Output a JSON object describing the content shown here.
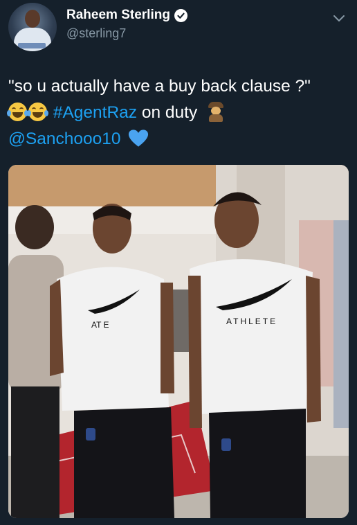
{
  "tweet": {
    "author": {
      "display_name": "Raheem Sterling",
      "handle": "@sterling7",
      "avatar_icon": "avatar",
      "verified_icon": "verified-badge-icon"
    },
    "text": {
      "line1": "\"so u actually have a buy back clause ?\"",
      "emoji_1": "face-with-tears-of-joy-icon",
      "hashtag": "#AgentRaz",
      "after_hashtag": " on duty",
      "emoji_2": "detective-icon",
      "mention": "@Sanchooo10",
      "emoji_3": "blue-heart-icon"
    },
    "photo": {
      "description_icon": "tweet-photo",
      "shirt_text_left": "AT     E",
      "shirt_text_right": "ATHLETE"
    },
    "menu_icon": "chevron-down-icon"
  },
  "colors": {
    "background": "#15202b",
    "link": "#1da1f2",
    "secondary_text": "#8899a6",
    "primary_text": "#ffffff"
  }
}
